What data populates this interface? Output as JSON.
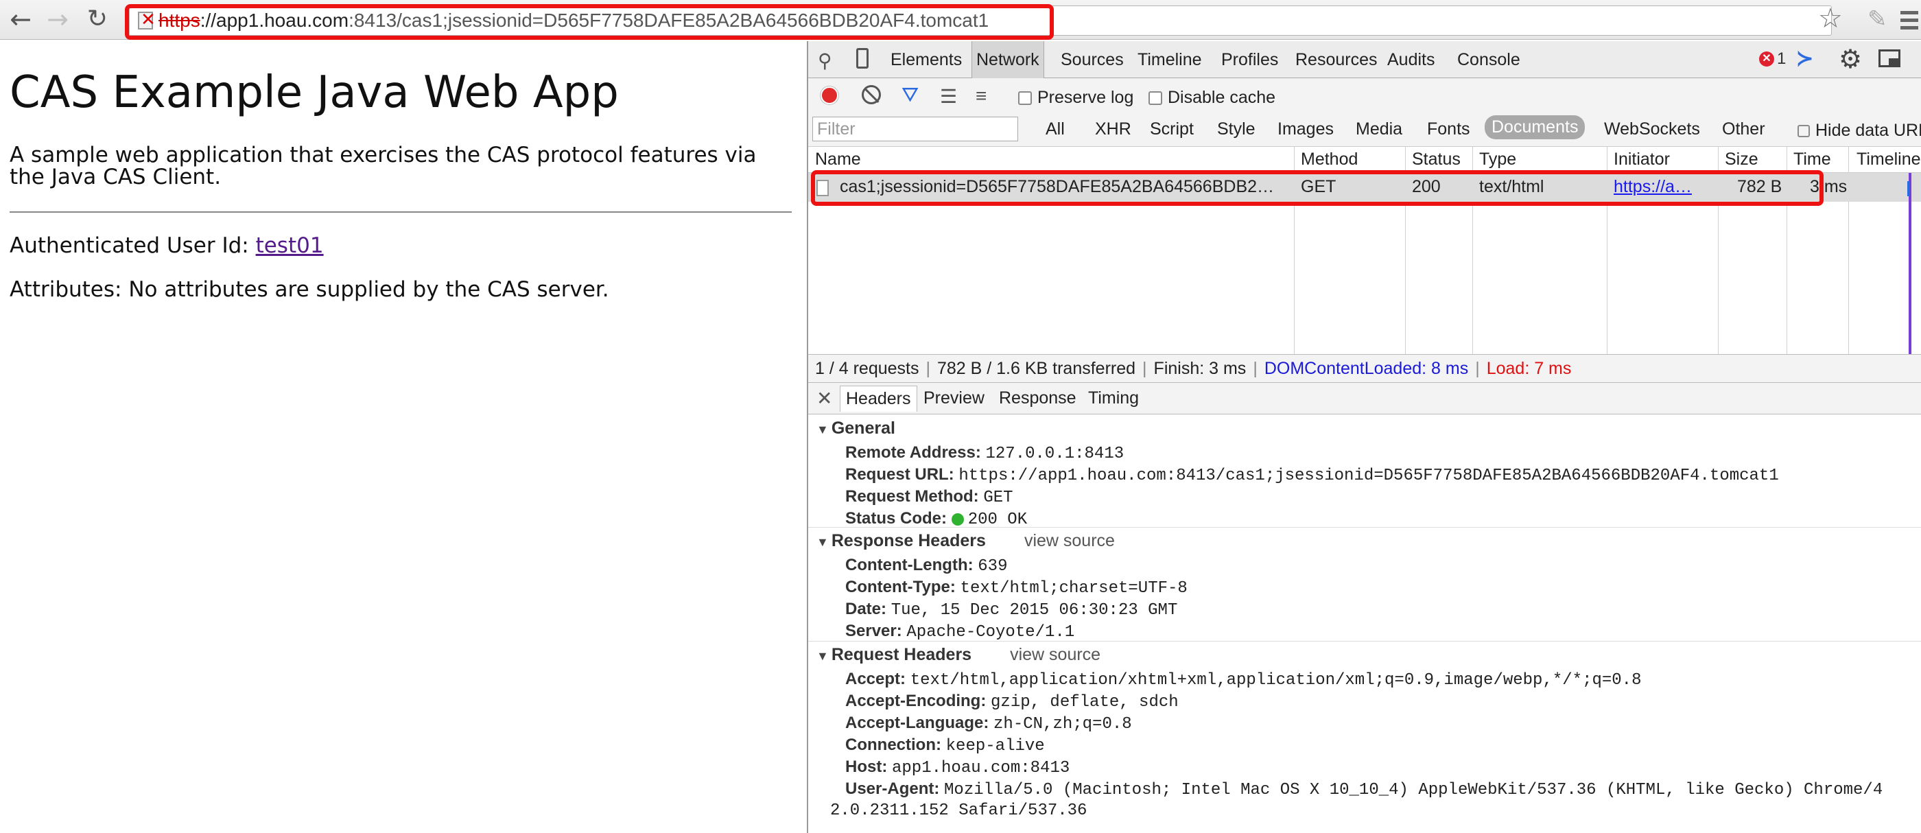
{
  "browser": {
    "url_scheme": "https",
    "url_host": "://app1.hoau.com",
    "url_rest": ":8413/cas1;jsessionid=D565F7758DAFE85A2BA64566BDB20AF4.tomcat1"
  },
  "page": {
    "title": "CAS Example Java Web App",
    "description": "A sample web application that exercises the CAS protocol features via the Java CAS Client.",
    "auth_label": "Authenticated User Id: ",
    "auth_user": "test01",
    "attributes_text": "Attributes: No attributes are supplied by the CAS server."
  },
  "devtools": {
    "tabs": [
      "Elements",
      "Network",
      "Sources",
      "Timeline",
      "Profiles",
      "Resources",
      "Audits",
      "Console"
    ],
    "error_count": "1",
    "preserve_log": "Preserve log",
    "disable_cache": "Disable cache",
    "filter_placeholder": "Filter",
    "filter_types": [
      "All",
      "XHR",
      "Script",
      "Style",
      "Images",
      "Media",
      "Fonts",
      "Documents",
      "WebSockets",
      "Other"
    ],
    "hide_data_urls": "Hide data URLs",
    "columns": [
      "Name",
      "Method",
      "Status",
      "Type",
      "Initiator",
      "Size",
      "Time",
      "Timeline"
    ],
    "row": {
      "name": "cas1;jsessionid=D565F7758DAFE85A2BA64566BDB2…",
      "method": "GET",
      "status": "200",
      "type": "text/html",
      "initiator": "https://a…",
      "size": "782 B",
      "time": "3 ms"
    },
    "summary": {
      "requests": "1 / 4 requests",
      "transferred": "782 B / 1.6 KB transferred",
      "finish": "Finish: 3 ms",
      "dom": "DOMContentLoaded: 8 ms",
      "load": "Load: 7 ms"
    },
    "detail_tabs": [
      "Headers",
      "Preview",
      "Response",
      "Timing"
    ],
    "general": {
      "title": "General",
      "remote_address_k": "Remote Address:",
      "remote_address_v": "127.0.0.1:8413",
      "request_url_k": "Request URL:",
      "request_url_v": "https://app1.hoau.com:8413/cas1;jsessionid=D565F7758DAFE85A2BA64566BDB20AF4.tomcat1",
      "request_method_k": "Request Method:",
      "request_method_v": "GET",
      "status_code_k": "Status Code:",
      "status_code_v": "200 OK"
    },
    "response_headers": {
      "title": "Response Headers",
      "view_source": "view source",
      "content_length_k": "Content-Length:",
      "content_length_v": "639",
      "content_type_k": "Content-Type:",
      "content_type_v": "text/html;charset=UTF-8",
      "date_k": "Date:",
      "date_v": "Tue, 15 Dec 2015 06:30:23 GMT",
      "server_k": "Server:",
      "server_v": "Apache-Coyote/1.1"
    },
    "request_headers": {
      "title": "Request Headers",
      "view_source": "view source",
      "accept_k": "Accept:",
      "accept_v": "text/html,application/xhtml+xml,application/xml;q=0.9,image/webp,*/*;q=0.8",
      "accept_encoding_k": "Accept-Encoding:",
      "accept_encoding_v": "gzip, deflate, sdch",
      "accept_language_k": "Accept-Language:",
      "accept_language_v": "zh-CN,zh;q=0.8",
      "connection_k": "Connection:",
      "connection_v": "keep-alive",
      "host_k": "Host:",
      "host_v": "app1.hoau.com:8413",
      "user_agent_k": "User-Agent:",
      "user_agent_v": "Mozilla/5.0 (Macintosh; Intel Mac OS X 10_10_4) AppleWebKit/537.36 (KHTML, like Gecko) Chrome/4",
      "user_agent_v2": "2.0.2311.152 Safari/537.36"
    }
  },
  "colors": {
    "highlight": "#ee1111",
    "record": "#e02a2a",
    "dom_loaded": "#1a1ad8",
    "load": "#e01010",
    "status_ok": "#2fb22f"
  }
}
